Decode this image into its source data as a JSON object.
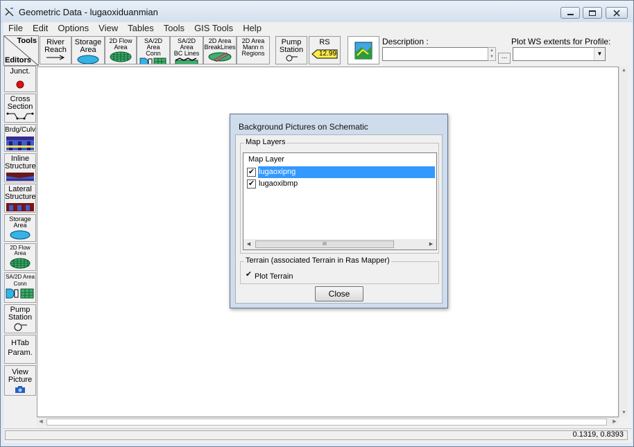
{
  "window": {
    "title": "Geometric Data - lugaoxiduanmian"
  },
  "menu": [
    "File",
    "Edit",
    "Options",
    "View",
    "Tables",
    "Tools",
    "GIS Tools",
    "Help"
  ],
  "toolbar": {
    "tools_label": "Tools",
    "editors_label": "Editors",
    "buttons": [
      {
        "line1": "River",
        "line2": "Reach"
      },
      {
        "line1": "Storage",
        "line2": "Area"
      },
      {
        "line1": "2D Flow",
        "line2": "Area"
      },
      {
        "line1": "SA/2D Area",
        "line2": "Conn"
      },
      {
        "line1": "SA/2D Area",
        "line2": "BC Lines"
      },
      {
        "line1": "2D Area",
        "line2": "BreakLines"
      },
      {
        "line1": "2D Area",
        "line2": "Mann n",
        "line3": "Regions"
      },
      {
        "line1": "Pump",
        "line2": "Station"
      },
      {
        "line1": "RS",
        "value": "12.99"
      }
    ],
    "description_label": "Description :",
    "description_value": "",
    "ellipsis": "...",
    "plot_ws_label": "Plot WS extents for Profile:",
    "plot_ws_value": ""
  },
  "editors": [
    {
      "line1": "Junct."
    },
    {
      "line1": "Cross",
      "line2": "Section"
    },
    {
      "line1": "Brdg/Culv"
    },
    {
      "line1": "Inline",
      "line2": "Structure"
    },
    {
      "line1": "Lateral",
      "line2": "Structure"
    },
    {
      "line1": "Storage",
      "line2": "Area"
    },
    {
      "line1": "2D Flow",
      "line2": "Area"
    },
    {
      "line1": "SA/2D Area",
      "line2": "Conn"
    },
    {
      "line1": "Pump",
      "line2": "Station"
    },
    {
      "line1": "HTab",
      "line2": "Param."
    },
    {
      "line1": "View",
      "line2": "Picture"
    }
  ],
  "status": {
    "coords": "0.1319, 0.8393"
  },
  "dialog": {
    "title": "Background Pictures on Schematic",
    "map_layers_group": "Map Layers",
    "list_header": "Map Layer",
    "layers": [
      {
        "name": "lugaoxipng",
        "checked": true,
        "selected": true
      },
      {
        "name": "lugaoxibmp",
        "checked": true,
        "selected": false
      }
    ],
    "scroll_grip": "III",
    "terrain_group": "Terrain (associated Terrain in Ras Mapper)",
    "plot_terrain_label": "Plot Terrain",
    "plot_terrain_checked": true,
    "close_label": "Close"
  },
  "colors": {
    "selection": "#3399ff",
    "dialog_frame": "#cfdcec",
    "window_frame": "#dfe8f3"
  },
  "icons": {
    "app": "hecras-icon",
    "check": "✔"
  }
}
